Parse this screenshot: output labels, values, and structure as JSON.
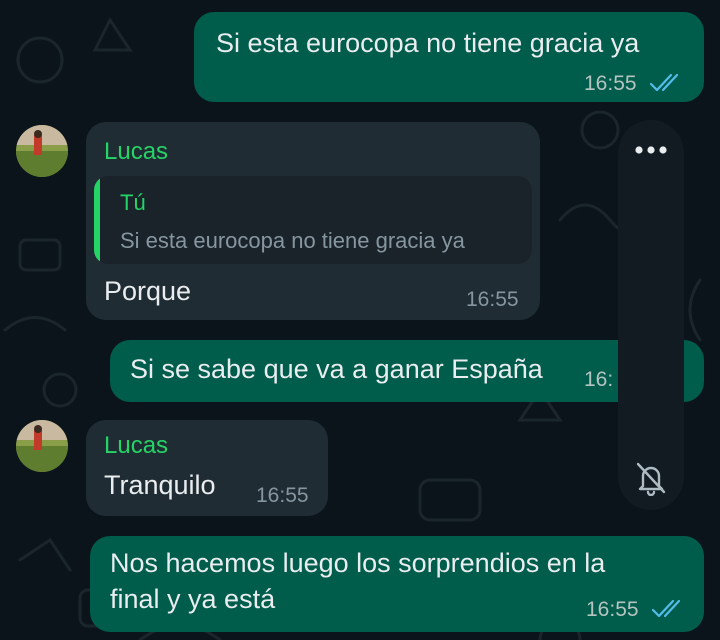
{
  "chat": {
    "messages": [
      {
        "direction": "outgoing",
        "text": "Si esta eurocopa no tiene gracia ya",
        "time": "16:55",
        "status": "read"
      },
      {
        "direction": "incoming",
        "sender": "Lucas",
        "quote": {
          "sender": "Tú",
          "text": "Si esta eurocopa no tiene gracia ya"
        },
        "text": "Porque",
        "time": "16:55"
      },
      {
        "direction": "outgoing",
        "text": "Si se sabe que va a ganar España",
        "time": "16:",
        "status": "read"
      },
      {
        "direction": "incoming",
        "sender": "Lucas",
        "text": "Tranquilo",
        "time": "16:55"
      },
      {
        "direction": "outgoing",
        "text_lines": [
          "Nos hacemos luego los sorprendios en la",
          "final y ya está"
        ],
        "time": "16:55",
        "status": "read"
      }
    ]
  },
  "overlay_panel": {
    "menu_icon": "more-dots-icon",
    "mute_icon": "bell-off-icon"
  },
  "colors": {
    "background": "#0b141a",
    "outgoing_bubble": "#005c4b",
    "incoming_bubble": "#202c33",
    "sender_name": "#25d366",
    "read_ticks": "#53bdeb"
  }
}
